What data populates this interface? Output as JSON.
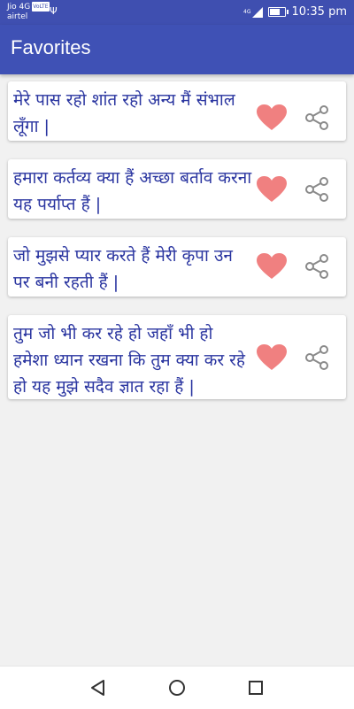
{
  "status_bar": {
    "carrier1": "Jio 4G",
    "volte": "VoLTE",
    "carrier2": "airtel",
    "network": "4G",
    "time": "10:35 pm"
  },
  "app_bar": {
    "title": "Favorites"
  },
  "quotes": [
    {
      "text": "मेरे पास रहो शांत रहो अन्य मैं संभाल लूँगा |"
    },
    {
      "text": "हमारा कर्तव्य क्या हैं अच्छा बर्ताव करना यह पर्याप्त हैं |"
    },
    {
      "text": "जो मुझसे प्यार करते हैं मेरी कृपा उन पर बनी रहती हैं |"
    },
    {
      "text": "तुम जो भी कर रहे हो जहाँ भी हो हमेशा ध्यान रखना कि तुम क्या कर रहे हो यह मुझे सदैव ज्ञात रहा हैं |"
    }
  ],
  "colors": {
    "app_bar": "#3f51b5",
    "status_bar": "#3f4fb0",
    "quote_text": "#2a35a0",
    "heart_fill": "#f08080",
    "share_icon": "#8a8a8a"
  },
  "icons": {
    "favorite": "heart-icon",
    "share": "share-icon",
    "nav_back": "back-icon",
    "nav_home": "home-icon",
    "nav_recents": "recents-icon"
  }
}
